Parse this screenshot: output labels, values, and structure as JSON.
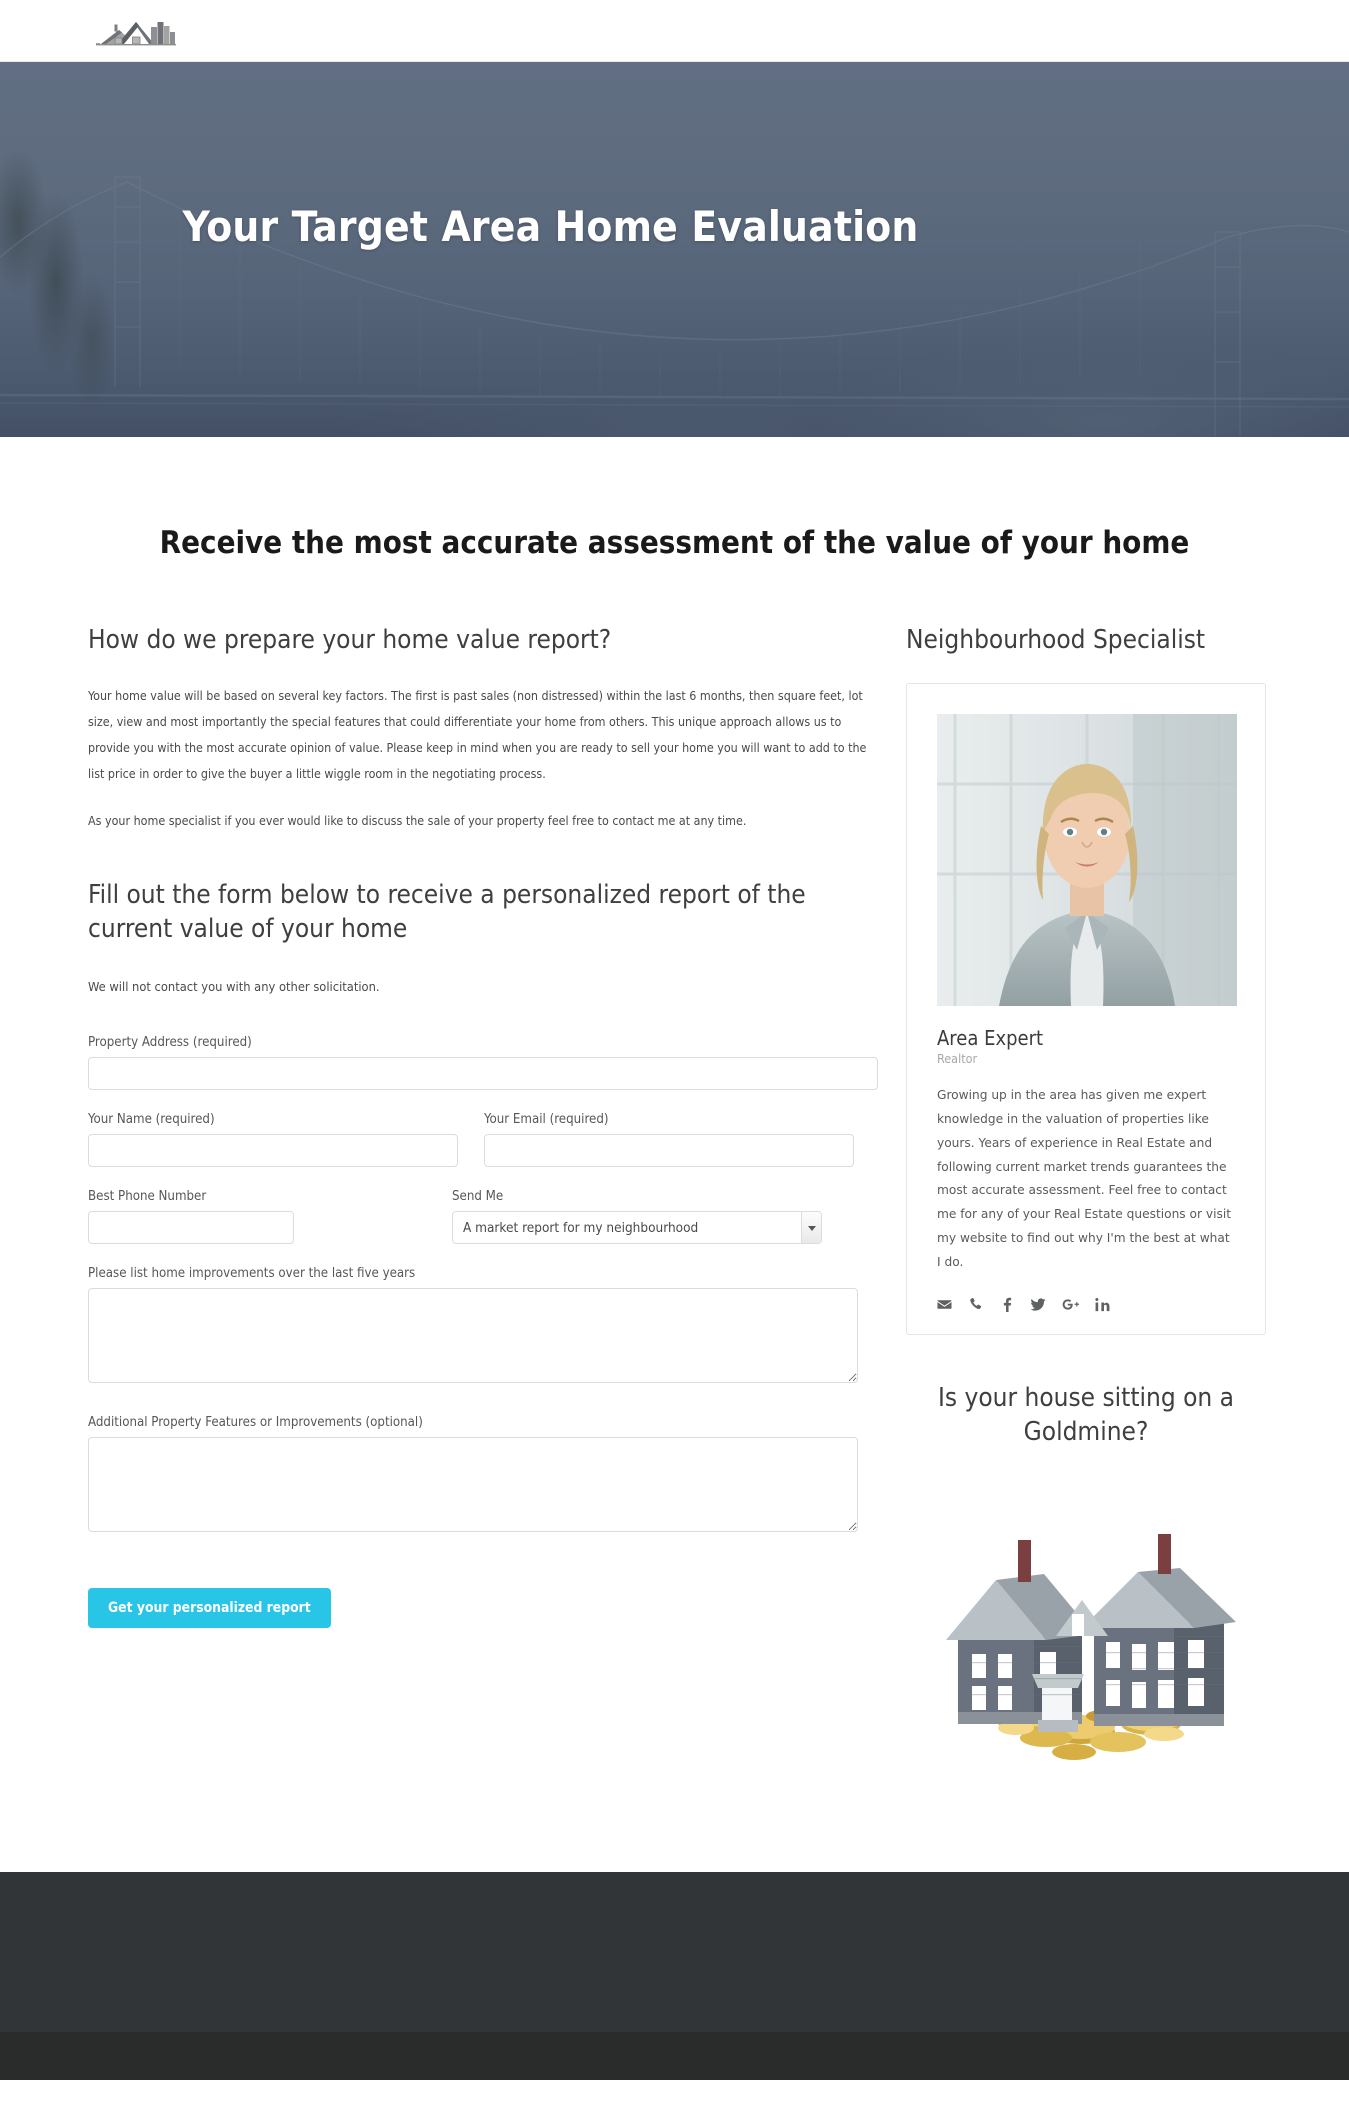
{
  "header": {
    "logo_name": "house-skyline-logo"
  },
  "hero": {
    "title": "Your Target Area Home Evaluation"
  },
  "main": {
    "section_title": "Receive the most accurate assessment of the value of your home",
    "left": {
      "heading": "How do we prepare your home value report?",
      "paragraph_1": "Your home value will be based on several key factors. The first is past sales (non distressed) within the last 6 months, then square feet, lot size, view and most importantly the special features that could differentiate your home from others. This unique approach allows us to provide you with the most accurate opinion of value. Please keep in mind when you are ready to sell your home you will want to add to the list price in order to give the buyer a little wiggle room in the negotiating process.",
      "paragraph_2": "As your home specialist if  you ever would like to discuss the sale of your property feel free to contact me at any time.",
      "form_heading": "Fill out the form below to receive a personalized report of the current value of your home",
      "privacy_note": "We will not contact you with any other solicitation."
    },
    "form": {
      "property_address_label": "Property Address (required)",
      "property_address_value": "",
      "name_label": "Your Name (required)",
      "name_value": "",
      "email_label": "Your Email (required)",
      "email_value": "",
      "phone_label": "Best Phone Number",
      "phone_value": "",
      "send_me_label": "Send Me",
      "send_me_selected": "A market report for my neighbourhood",
      "send_me_options": [
        "A market report for my neighbourhood"
      ],
      "improvements_label": "Please list home improvements over the last five years",
      "improvements_value": "",
      "features_label": "Additional Property Features or Improvements (optional)",
      "features_value": "",
      "submit_label": "Get your personalized report",
      "submit_color": "#29c5e6"
    },
    "right": {
      "specialist_heading": "Neighbourhood Specialist",
      "agent": {
        "photo_name": "agent-portrait",
        "name": "Area Expert",
        "role": "Realtor",
        "bio": "Growing up in the area has given me expert knowledge in the valuation of properties like yours. Years of experience in Real Estate and following current market trends guarantees the most accurate assessment. Feel free to contact me for any of your Real Estate questions or visit my website to find out why I'm the best at what I do.",
        "social": [
          {
            "name": "email-icon"
          },
          {
            "name": "phone-icon"
          },
          {
            "name": "facebook-icon"
          },
          {
            "name": "twitter-icon"
          },
          {
            "name": "google-plus-icon"
          },
          {
            "name": "linkedin-icon"
          }
        ]
      },
      "goldmine_heading": "Is your house sitting on a Goldmine?",
      "goldmine_image_name": "house-on-coins-image"
    }
  },
  "footer": {
    "top_color": "#313537",
    "bottom_color": "#2a2c2c"
  }
}
